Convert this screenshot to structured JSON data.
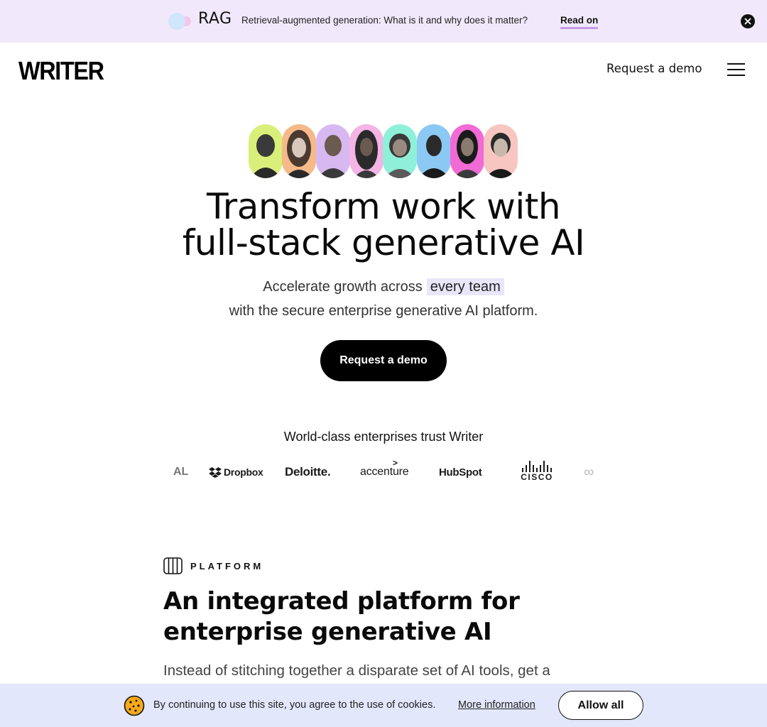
{
  "announcement": {
    "label": "RAG",
    "message": "Retrieval-augmented generation: What is it and why does it matter?",
    "link": "Read on",
    "close_icon": "close-icon",
    "accent_colors": [
      "#cfe6fb",
      "#f7c4ea"
    ]
  },
  "header": {
    "logo": "WRITER",
    "nav_cta": "Request a demo",
    "menu_icon": "hamburger-menu-icon"
  },
  "hero": {
    "avatar_colors": [
      "#d9ef7a",
      "#f6b98a",
      "#d8b8f0",
      "#f4b4e4",
      "#8ef0d8",
      "#8cc8f4",
      "#f26ad6",
      "#f8c6c0"
    ],
    "title_line1": "Transform work with",
    "title_line2": "full-stack generative AI",
    "subtitle_prefix": "Accelerate growth across",
    "subtitle_highlight": "every team",
    "subtitle_line2": "with the secure enterprise generative AI platform.",
    "cta": "Request a demo"
  },
  "trust": {
    "heading": "World-class enterprises trust Writer",
    "logos": [
      "AL",
      "Dropbox",
      "Deloitte.",
      "accenture",
      "HubSpot",
      "CISCO"
    ]
  },
  "platform": {
    "eyebrow": "PLATFORM",
    "title_line1": "An integrated platform for",
    "title_line2": "enterprise generative AI",
    "body": "Instead of stitching together a disparate set of AI tools, get a"
  },
  "cookie_banner": {
    "text": "By continuing to use this site, you agree to the use of cookies.",
    "link": "More information",
    "button": "Allow all"
  }
}
